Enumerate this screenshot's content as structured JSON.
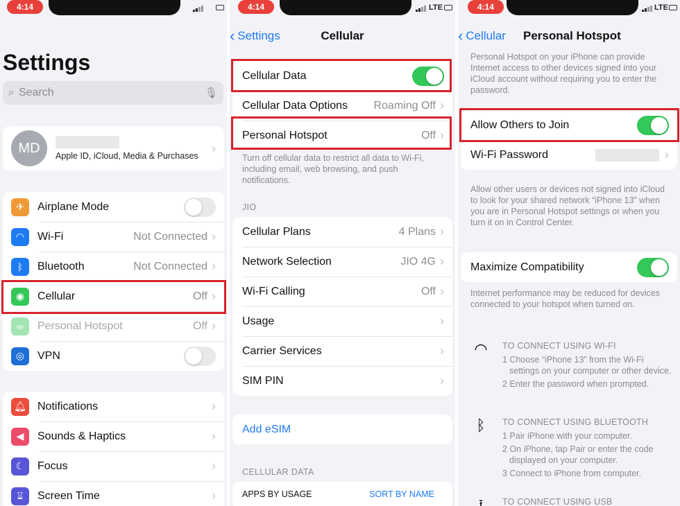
{
  "status": {
    "time": "4:14",
    "network": "LTE"
  },
  "colors": {
    "accent": "#1f7bf2",
    "toggle_on": "#34c759",
    "highlight": "#d6232c",
    "time_pill": "#e8403a"
  },
  "settings": {
    "title": "Settings",
    "search_placeholder": "Search",
    "account": {
      "initials": "MD",
      "subtitle": "Apple ID, iCloud, Media & Purchases"
    },
    "group1": [
      {
        "label": "Airplane Mode",
        "icon": "airplane-icon",
        "color": "#f09a37"
      },
      {
        "label": "Wi-Fi",
        "value": "Not Connected",
        "icon": "wifi-icon",
        "color": "#1f7bf2"
      },
      {
        "label": "Bluetooth",
        "value": "Not Connected",
        "icon": "bluetooth-icon",
        "color": "#1f7bf2"
      },
      {
        "label": "Cellular",
        "value": "Off",
        "icon": "cellular-icon",
        "color": "#34c759"
      },
      {
        "label": "Personal Hotspot",
        "value": "Off",
        "icon": "hotspot-icon",
        "color": "#34c759"
      },
      {
        "label": "VPN",
        "icon": "vpn-icon",
        "color": "#1f6fd6"
      }
    ],
    "group2": [
      {
        "label": "Notifications",
        "icon": "bell-icon",
        "color": "#eb4d3d"
      },
      {
        "label": "Sounds & Haptics",
        "icon": "speaker-icon",
        "color": "#eb4d6a"
      },
      {
        "label": "Focus",
        "icon": "moon-icon",
        "color": "#5856d6"
      },
      {
        "label": "Screen Time",
        "icon": "hourglass-icon",
        "color": "#5856d6"
      }
    ]
  },
  "cellular": {
    "back": "Settings",
    "title": "Cellular",
    "rows_top": [
      {
        "label": "Cellular Data"
      },
      {
        "label": "Cellular Data Options",
        "value": "Roaming Off"
      },
      {
        "label": "Personal Hotspot",
        "value": "Off"
      }
    ],
    "footer": "Turn off cellular data to restrict all data to Wi-Fi, including email, web browsing, and push notifications.",
    "carrier_header": "JIO",
    "carrier_rows": [
      {
        "label": "Cellular Plans",
        "value": "4 Plans"
      },
      {
        "label": "Network Selection",
        "value": "JIO 4G"
      },
      {
        "label": "Wi-Fi Calling",
        "value": "Off"
      },
      {
        "label": "Usage",
        "value": ""
      },
      {
        "label": "Carrier Services",
        "value": ""
      },
      {
        "label": "SIM PIN",
        "value": ""
      }
    ],
    "add_esim": "Add eSIM",
    "data_header": "CELLULAR DATA",
    "apps_by_usage": "APPS BY USAGE",
    "sort_by_name": "SORT BY NAME"
  },
  "hotspot": {
    "back": "Cellular",
    "title": "Personal Hotspot",
    "intro": "Personal Hotspot on your iPhone can provide Internet access to other devices signed into your iCloud account without requiring you to enter the password.",
    "allow_label": "Allow Others to Join",
    "wifi_password_label": "Wi-Fi Password",
    "allow_footer": "Allow other users or devices not signed into iCloud to look for your shared network “iPhone 13” when you are in Personal Hotspot settings or when you turn it on in Control Center.",
    "maximize_label": "Maximize Compatibility",
    "maximize_footer": "Internet performance may be reduced for devices connected to your hotspot when turned on.",
    "wifi_connect": {
      "header": "TO CONNECT USING WI-FI",
      "steps": [
        "1 Choose “iPhone 13” from the Wi-Fi settings on your computer or other device.",
        "2 Enter the password when prompted."
      ]
    },
    "bt_connect": {
      "header": "TO CONNECT USING BLUETOOTH",
      "steps": [
        "1 Pair iPhone with your computer.",
        "2 On iPhone, tap Pair or enter the code displayed on your computer.",
        "3 Connect to iPhone from computer."
      ]
    },
    "usb_connect": {
      "header": "TO CONNECT USING USB"
    }
  }
}
